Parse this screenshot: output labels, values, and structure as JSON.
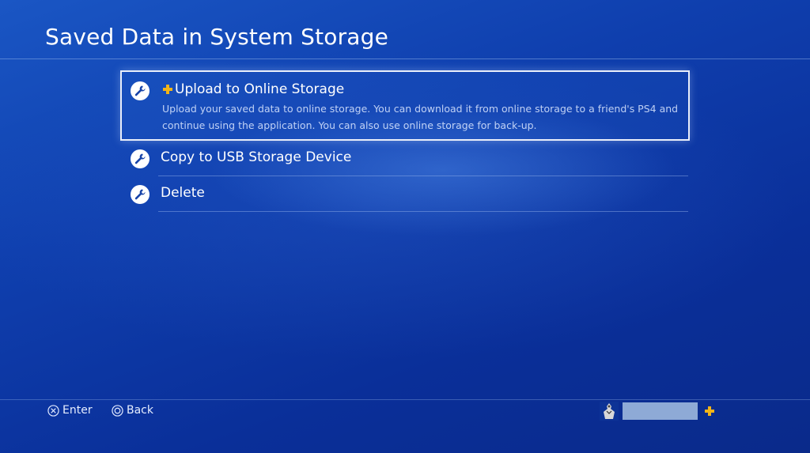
{
  "header": {
    "title": "Saved Data in System Storage"
  },
  "menu": {
    "items": [
      {
        "label": "Upload to Online Storage",
        "description": "Upload your saved data to online storage. You can download it from online storage to a friend's PS4 and continue using the application. You can also use online storage for back-up.",
        "icon": "wrench-icon",
        "badge_icon": "ps-plus-icon",
        "focused": true
      },
      {
        "label": "Copy to USB Storage Device",
        "icon": "wrench-icon",
        "focused": false
      },
      {
        "label": "Delete",
        "icon": "wrench-icon",
        "focused": false
      }
    ]
  },
  "footer": {
    "enter_label": "Enter",
    "enter_icon": "cross-button-icon",
    "back_label": "Back",
    "back_icon": "circle-button-icon",
    "user_icon": "avatar-icon",
    "membership_icon": "ps-plus-icon"
  },
  "colors": {
    "accent_plus": "#f2b418",
    "background": "#0f3fae",
    "focus_border": "#e9eefa"
  }
}
